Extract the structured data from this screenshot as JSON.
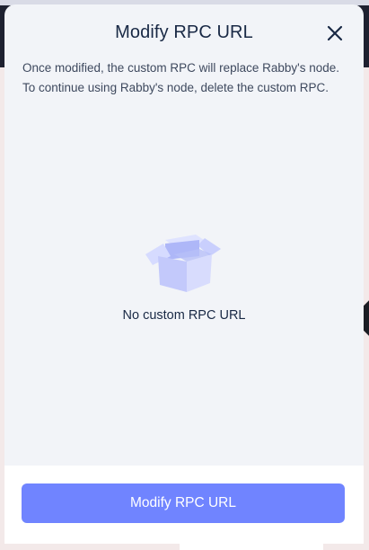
{
  "modal": {
    "title": "Modify RPC URL",
    "description": "Once modified, the custom RPC will replace Rabby's node. To continue using Rabby's node, delete the custom RPC.",
    "empty_text": "No custom RPC URL",
    "primary_button_label": "Modify RPC URL"
  },
  "icons": {
    "close": "close-icon",
    "empty": "empty-box-icon"
  },
  "colors": {
    "accent": "#7084ff",
    "title": "#192945",
    "body_text": "#3e495e",
    "modal_bg": "#f2f4f8"
  }
}
